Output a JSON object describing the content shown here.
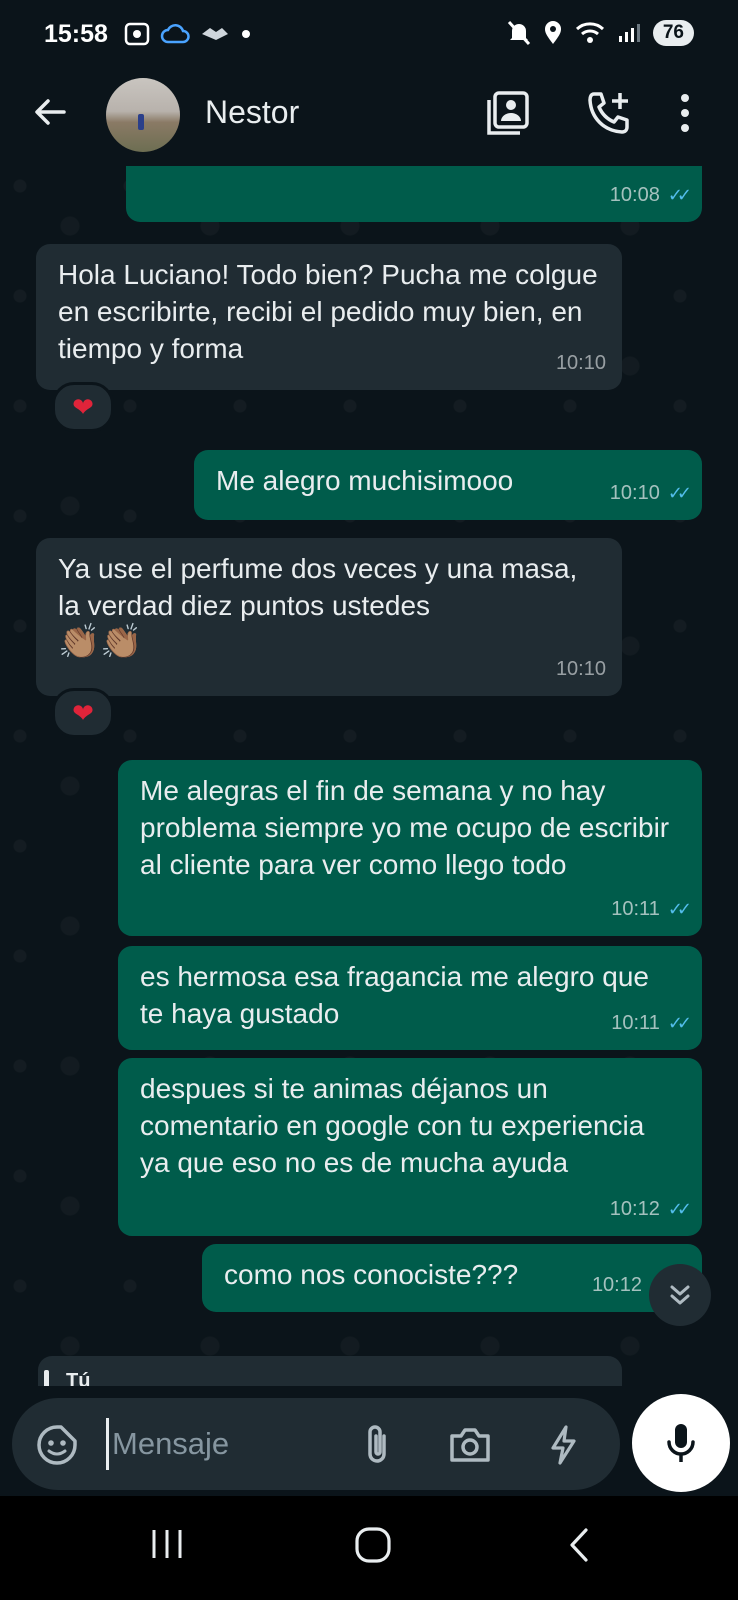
{
  "status_bar": {
    "time": "15:58",
    "battery": "76"
  },
  "header": {
    "contact_name": "Nestor"
  },
  "messages": [
    {
      "direction": "out",
      "text": "",
      "time": "10:08"
    },
    {
      "direction": "in",
      "text": "Hola Luciano! Todo bien? Pucha me colgue en escribirte, recibi el pedido muy bien, en tiempo y forma",
      "time": "10:10",
      "reaction": "❤"
    },
    {
      "direction": "out",
      "text": "Me alegro muchisimooo",
      "time": "10:10"
    },
    {
      "direction": "in",
      "text": "Ya use el perfume dos veces y una masa, la verdad diez puntos ustedes",
      "emojis": "👏🏽👏🏽",
      "time": "10:10",
      "reaction": "❤"
    },
    {
      "direction": "out",
      "text": "Me alegras el fin de semana y no hay problema siempre yo me ocupo de escribir al cliente para ver como llego todo",
      "time": "10:11"
    },
    {
      "direction": "out",
      "text": "es hermosa esa fragancia me alegro que te haya gustado",
      "time": "10:11"
    },
    {
      "direction": "out",
      "text": "despues si te animas déjanos un comentario en google con tu experiencia ya que eso no es de mucha ayuda",
      "time": "10:12"
    },
    {
      "direction": "out",
      "text": "como nos conociste???",
      "time": "10:12"
    }
  ],
  "reply_preview": {
    "sender": "Tú"
  },
  "composer": {
    "placeholder": "Mensaje"
  },
  "icons": {
    "back": "arrow-left-icon",
    "contact_card": "contact-card-icon",
    "add_call": "phone-plus-icon",
    "menu": "more-vertical-icon",
    "sticker": "sticker-icon",
    "attach": "paperclip-icon",
    "camera": "camera-icon",
    "quick": "lightning-icon",
    "mic": "mic-icon",
    "scroll": "chevron-double-down-icon"
  },
  "colors": {
    "background": "#0b141a",
    "outgoing_bubble": "#005c4b",
    "incoming_bubble": "#202c33",
    "read_ticks": "#53bdeb"
  }
}
